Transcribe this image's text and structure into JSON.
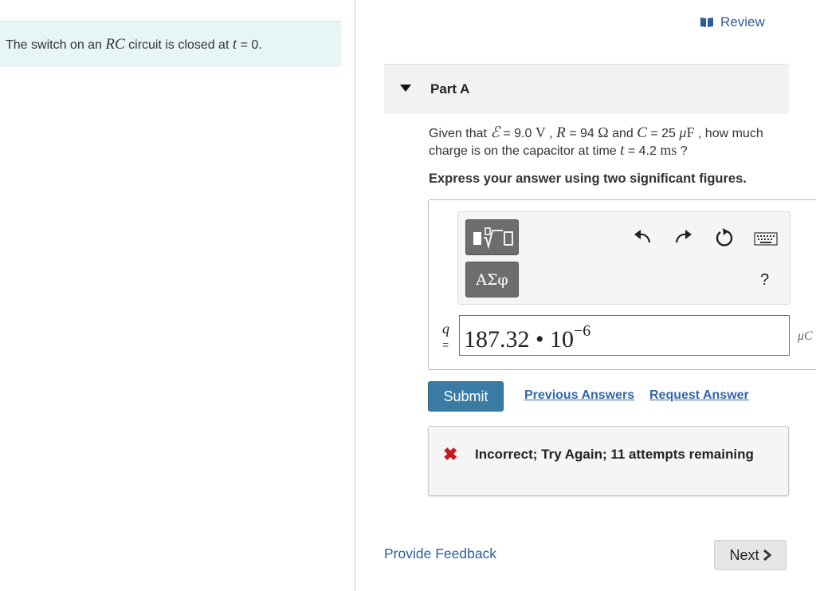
{
  "intro": {
    "text_before": "The switch on an ",
    "rc": "RC",
    "text_middle": " circuit is closed at ",
    "t": "t",
    "text_after": " = 0."
  },
  "review": {
    "label": "Review",
    "icon": "book-icon"
  },
  "part": {
    "title": "Part A"
  },
  "question": {
    "given": "Given that ",
    "emf_sym": "ℰ",
    "emf_val": " = 9.0 ",
    "emf_unit": "V",
    "sep1": " , ",
    "r_sym": "R",
    "r_val": " = 94 ",
    "r_unit": "Ω",
    "and": " and ",
    "c_sym": "C",
    "c_val": " = 25 ",
    "c_unit": "μF",
    "tail1": " , how much charge is on the capacitor at time ",
    "t_sym": "t",
    "t_val": " = 4.2 ",
    "t_unit": "ms",
    "tail2": " ?"
  },
  "instruction": "Express your answer using two significant figures.",
  "toolbar": {
    "greek_label": "ΑΣφ",
    "help_label": "?",
    "icons": [
      "templates-icon",
      "undo-icon",
      "redo-icon",
      "reset-icon",
      "keyboard-icon"
    ]
  },
  "answer": {
    "variable": "q",
    "equals": "=",
    "mantissa": "187.32 • 10",
    "exponent": "−6",
    "unit": "μC"
  },
  "actions": {
    "submit_label": "Submit",
    "previous_answers": "Previous Answers",
    "request_answer": "Request Answer"
  },
  "feedback": {
    "message": "Incorrect; Try Again; 11 attempts remaining",
    "icon": "x-icon",
    "color": "#c8181d"
  },
  "footer": {
    "provide_feedback": "Provide Feedback",
    "next_label": "Next"
  },
  "colors": {
    "accent": "#397ba3",
    "link": "#3167a8",
    "intro_bg": "#e8f5f5"
  }
}
